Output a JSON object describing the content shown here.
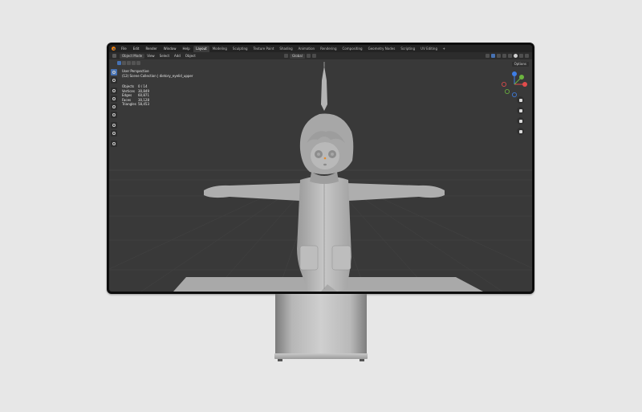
{
  "menu": {
    "items": [
      "File",
      "Edit",
      "Render",
      "Window",
      "Help"
    ]
  },
  "workspaces": {
    "tabs": [
      "Layout",
      "Modeling",
      "Sculpting",
      "Texture Paint",
      "Shading",
      "Animation",
      "Rendering",
      "Compositing",
      "Geometry Nodes",
      "Scripting",
      "UV Editing"
    ],
    "active": "Layout",
    "add": "+"
  },
  "header": {
    "mode": "Object Mode",
    "view_menus": [
      "View",
      "Select",
      "Add",
      "Object"
    ],
    "orientation": "Global",
    "options": "Options"
  },
  "viewport": {
    "view_name": "User Perspective",
    "collection": "(12) Scene Collection | dietory_eyelid_upper",
    "stats": [
      {
        "label": "Objects",
        "value": "0 / 14"
      },
      {
        "label": "Vertices",
        "value": "30,849"
      },
      {
        "label": "Edges",
        "value": "60,871"
      },
      {
        "label": "Faces",
        "value": "30,128"
      },
      {
        "label": "Triangles",
        "value": "58,453"
      }
    ]
  },
  "gizmo": {
    "axes": [
      "X",
      "Y",
      "Z"
    ],
    "colors": {
      "x": "#e34c4c",
      "y": "#6cb53f",
      "z": "#3e7ee6"
    }
  },
  "colors": {
    "background": "#e7e7e7",
    "viewport": "#393939",
    "accent": "#4772b3"
  }
}
